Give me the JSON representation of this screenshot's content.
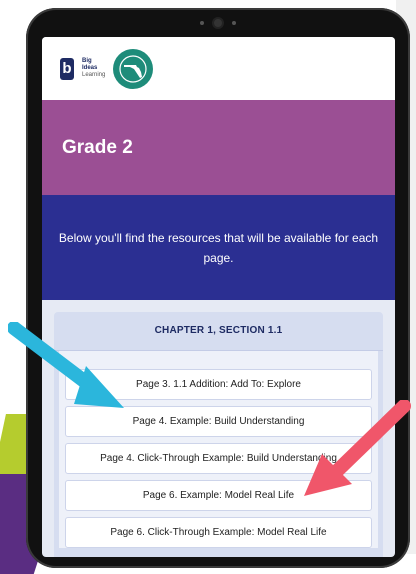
{
  "logo": {
    "brand_line1": "Big",
    "brand_line2": "Ideas",
    "brand_line3": "Learning",
    "colors": {
      "brand": "#1e2b63",
      "state_badge": "#1e8c7a"
    }
  },
  "grade": {
    "title": "Grade 2",
    "color": "#9b4f94"
  },
  "intro": {
    "text": "Below you'll find the resources that will be available for each page.",
    "color": "#2b2f92"
  },
  "section": {
    "title": "CHAPTER 1, SECTION 1.1",
    "items": [
      "Page 3. 1.1 Addition: Add To:  Explore",
      "Page 4. Example:  Build Understanding",
      "Page 4. Click-Through Example:  Build Understanding",
      "Page 6. Example:  Model Real Life",
      "Page 6. Click-Through Example:  Model Real Life"
    ]
  },
  "annotations": {
    "arrow_left_color": "#2bb6dc",
    "arrow_right_color": "#f0566a"
  }
}
